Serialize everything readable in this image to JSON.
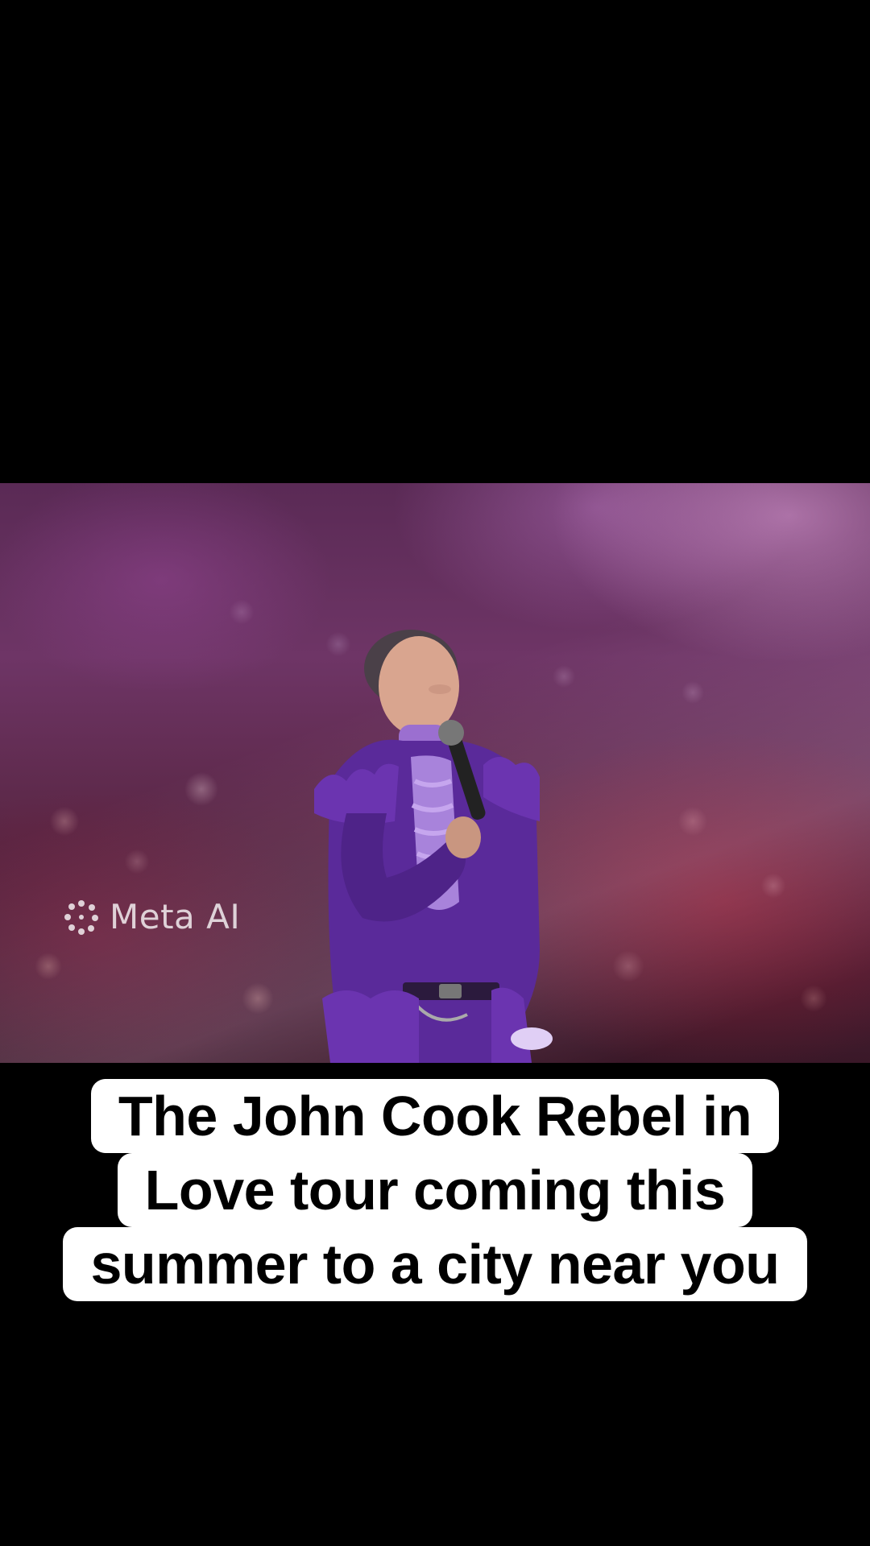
{
  "watermark": {
    "icon": "meta-ai-sparkle-icon",
    "label": "Meta AI"
  },
  "caption": {
    "lines": [
      "The John Cook Rebel in",
      "Love tour coming this",
      "summer to a city near you"
    ]
  },
  "colors": {
    "background": "#000000",
    "caption_bg": "#ffffff",
    "caption_text": "#000000",
    "costume_purple": "#5a2a9a"
  }
}
